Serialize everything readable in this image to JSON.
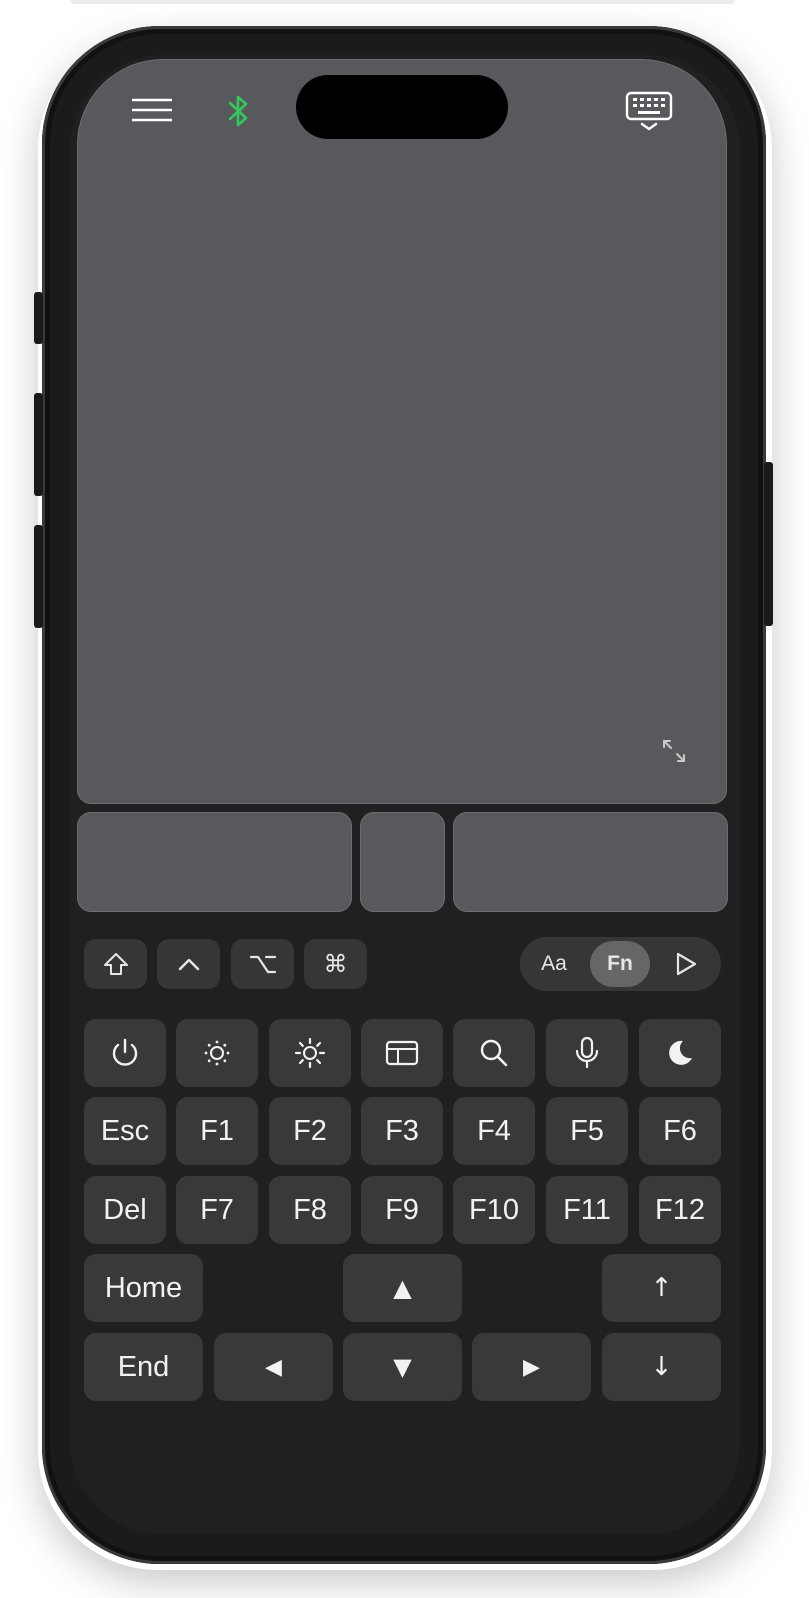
{
  "colors": {
    "bluetooth": "#34c759",
    "trackpad": "#57595c",
    "key": "#393939",
    "screen": "#202020"
  },
  "header": {
    "menu_icon": "hamburger-menu-icon",
    "bluetooth_icon": "bluetooth-icon",
    "keyboard_icon": "keyboard-hide-icon"
  },
  "trackpad": {
    "expand_icon": "expand-arrows-icon"
  },
  "modifiers": [
    {
      "name": "shift",
      "glyph": "⇧"
    },
    {
      "name": "control",
      "glyph": "^"
    },
    {
      "name": "option",
      "glyph": "⌥"
    },
    {
      "name": "command",
      "glyph": "⌘"
    }
  ],
  "mode": {
    "letters": "Aa",
    "fn": "Fn",
    "selected": "Fn",
    "play_icon": "play-triangle-icon"
  },
  "media_keys": [
    "power-icon",
    "brightness-down-icon",
    "brightness-up-icon",
    "mission-control-icon",
    "search-icon",
    "microphone-icon",
    "do-not-disturb-moon-icon"
  ],
  "fn_row1": [
    "Esc",
    "F1",
    "F2",
    "F3",
    "F4",
    "F5",
    "F6"
  ],
  "fn_row2": [
    "Del",
    "F7",
    "F8",
    "F9",
    "F10",
    "F11",
    "F12"
  ],
  "nav": {
    "home": "Home",
    "end": "End",
    "up": "▲",
    "down": "▼",
    "left": "◀",
    "right": "▶",
    "page_up": "↑",
    "page_down": "↓"
  }
}
